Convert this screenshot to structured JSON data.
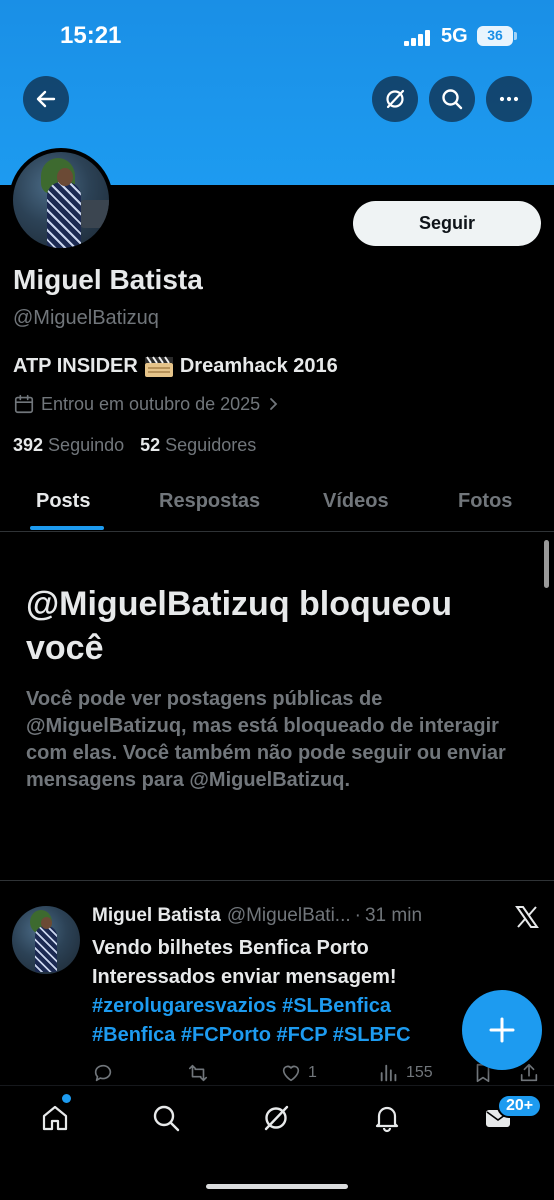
{
  "status_bar": {
    "time": "15:21",
    "network": "5G",
    "battery": "36"
  },
  "header": {
    "back_icon": "arrow-left-icon",
    "grok_icon": "grok-icon",
    "search_icon": "search-icon",
    "more_icon": "more-icon"
  },
  "profile": {
    "name": "Miguel Batista",
    "handle": "@MiguelBatizuq",
    "follow_label": "Seguir",
    "bio_part1": "ATP INSIDER",
    "bio_part2": "Dreamhack 2016",
    "joined": "Entrou em outubro de 2025",
    "following_count": "392",
    "following_label": "Seguindo",
    "followers_count": "52",
    "followers_label": "Seguidores"
  },
  "tabs": [
    {
      "label": "Posts",
      "active": true
    },
    {
      "label": "Respostas",
      "active": false
    },
    {
      "label": "Vídeos",
      "active": false
    },
    {
      "label": "Fotos",
      "active": false
    }
  ],
  "blocked": {
    "title": "@MiguelBatizuq bloqueou você",
    "message": "Você pode ver postagens públicas de @MiguelBatizuq, mas está bloqueado de interagir com elas. Você também não pode seguir ou enviar mensagens para @MiguelBatizuq."
  },
  "tweet": {
    "author": "Miguel Batista",
    "handle": "@MiguelBati...",
    "separator": "·",
    "time": "31 min",
    "line1": "Vendo bilhetes Benfica Porto",
    "line2": "Interessados enviar mensagem!",
    "tags_line1": "#zerolugaresvazios #SLBenfica",
    "tags_line2": "#Benfica #FCPorto #FCP #SLBFC",
    "likes": "1",
    "views": "155"
  },
  "bottom_nav": {
    "messages_badge": "20+"
  },
  "colors": {
    "accent": "#1d9bf0",
    "banner": "#1d9bf0",
    "background": "#000000",
    "secondary_text": "#71767b"
  }
}
